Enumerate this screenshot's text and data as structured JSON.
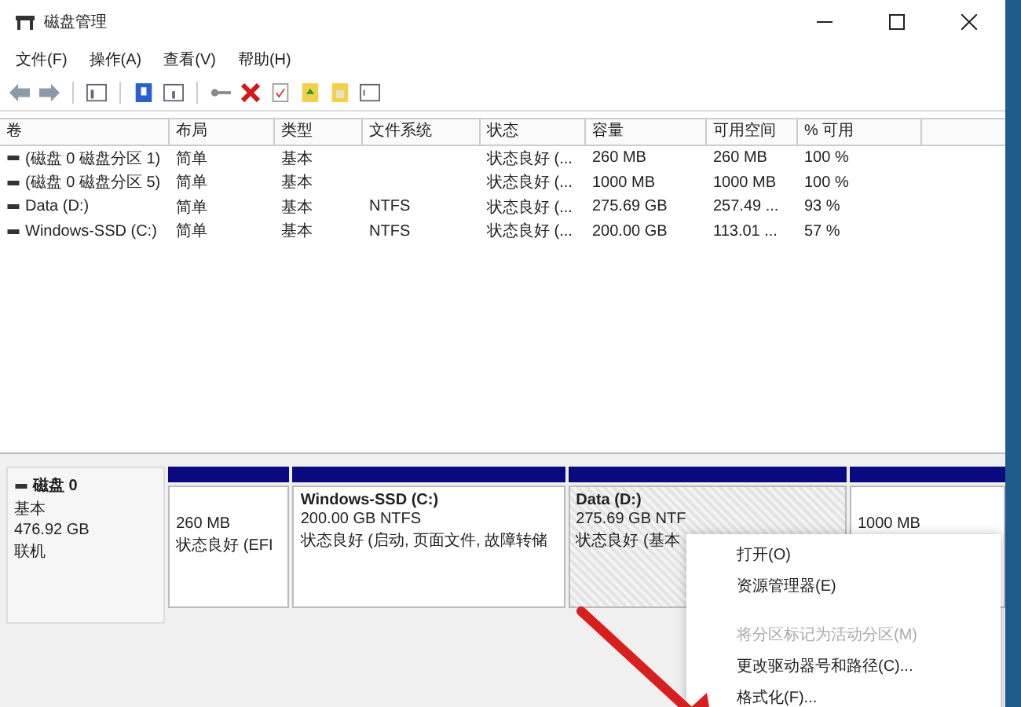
{
  "window": {
    "title": "磁盘管理"
  },
  "menu": [
    "文件(F)",
    "操作(A)",
    "查看(V)",
    "帮助(H)"
  ],
  "table": {
    "columns": [
      "卷",
      "布局",
      "类型",
      "文件系统",
      "状态",
      "容量",
      "可用空间",
      "% 可用"
    ],
    "rows": [
      [
        "(磁盘 0 磁盘分区 1)",
        "简单",
        "基本",
        "",
        "状态良好 (...",
        "260 MB",
        "260 MB",
        "100 %"
      ],
      [
        "(磁盘 0 磁盘分区 5)",
        "简单",
        "基本",
        "",
        "状态良好 (...",
        "1000 MB",
        "1000 MB",
        "100 %"
      ],
      [
        "Data (D:)",
        "简单",
        "基本",
        "NTFS",
        "状态良好 (...",
        "275.69 GB",
        "257.49 ...",
        "93 %"
      ],
      [
        "Windows-SSD (C:)",
        "简单",
        "基本",
        "NTFS",
        "状态良好 (...",
        "200.00 GB",
        "113.01 ...",
        "57 %"
      ]
    ]
  },
  "disk": {
    "name": "磁盘 0",
    "type": "基本",
    "size": "476.92 GB",
    "status": "联机",
    "partitions": [
      {
        "size": "260 MB",
        "status": "状态良好 (EFI",
        "selected": false
      },
      {
        "name": "Windows-SSD  (C:)",
        "size": "200.00 GB NTFS",
        "status": "状态良好 (启动, 页面文件, 故障转储",
        "selected": false
      },
      {
        "name": "Data  (D:)",
        "size": "275.69 GB NTF",
        "status": "状态良好 (基本",
        "selected": true
      },
      {
        "size": "1000 MB",
        "selected": false
      }
    ]
  },
  "context_menu": [
    {
      "kind": "item",
      "label": "打开(O)",
      "disabled": false
    },
    {
      "kind": "item",
      "label": "资源管理器(E)",
      "disabled": false
    },
    {
      "kind": "separator"
    },
    {
      "kind": "item",
      "label": "将分区标记为活动分区(M)",
      "disabled": true
    },
    {
      "kind": "item",
      "label": "更改驱动器号和路径(C)...",
      "disabled": false
    },
    {
      "kind": "item",
      "label": "格式化(F)...",
      "disabled": false
    }
  ]
}
